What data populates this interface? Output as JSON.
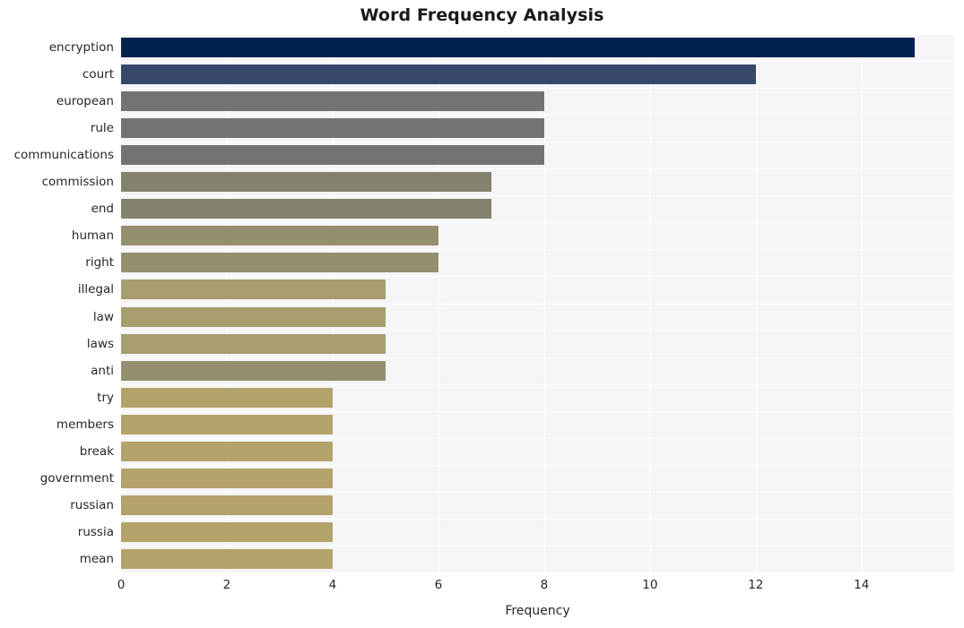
{
  "chart_data": {
    "type": "bar",
    "orientation": "horizontal",
    "title": "Word Frequency Analysis",
    "xlabel": "Frequency",
    "ylabel": "",
    "categories": [
      "encryption",
      "court",
      "european",
      "rule",
      "communications",
      "commission",
      "end",
      "human",
      "right",
      "illegal",
      "law",
      "laws",
      "anti",
      "try",
      "members",
      "break",
      "government",
      "russian",
      "russia",
      "mean"
    ],
    "values": [
      15,
      12,
      8,
      8,
      8,
      7,
      7,
      6,
      6,
      5,
      5,
      5,
      5,
      4,
      4,
      4,
      4,
      4,
      4,
      4
    ],
    "bar_colors": [
      "#00224e",
      "#38486b",
      "#737373",
      "#737373",
      "#737373",
      "#83826e",
      "#83826e",
      "#938f6f",
      "#938f6f",
      "#a79d6d",
      "#a79d6d",
      "#a79d6d",
      "#938f6f",
      "#b3a269",
      "#b3a269",
      "#b3a269",
      "#b3a269",
      "#b3a269",
      "#b3a269",
      "#b3a269"
    ],
    "xlim": [
      0,
      15.75
    ],
    "xticks": [
      0,
      2,
      4,
      6,
      8,
      10,
      12,
      14
    ],
    "xtick_labels": [
      "0",
      "2",
      "4",
      "6",
      "8",
      "10",
      "12",
      "14"
    ],
    "grid": true,
    "grid_color": "#ffffff",
    "grid_axis": "both",
    "legend": null,
    "plot_background": "#f5f5f7",
    "figure_background": "#ffffff",
    "title_color": "#1a1a1a",
    "tick_label_color": "#262626"
  }
}
